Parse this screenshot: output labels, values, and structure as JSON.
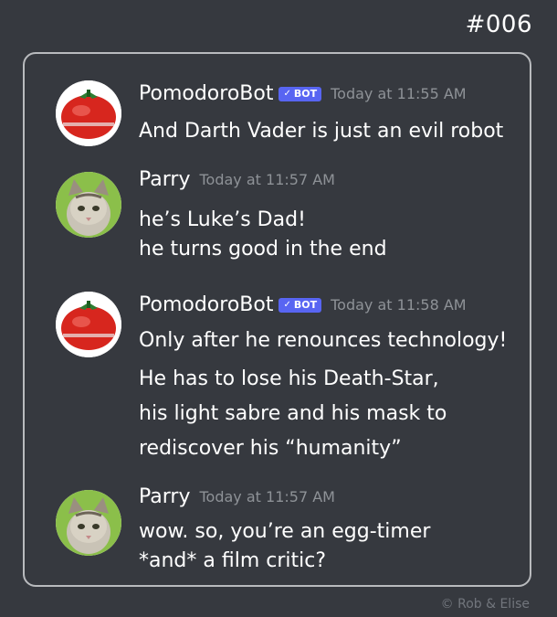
{
  "issue_number": "#006",
  "messages": [
    {
      "author": "PomodoroBot",
      "bot_tag": "BOT",
      "timestamp": "Today at 11:55 AM",
      "lines": [
        "And Darth Vader is just an evil robot"
      ]
    },
    {
      "author": "Parry",
      "timestamp": "Today at 11:57 AM",
      "lines": [
        "he’s Luke’s Dad!",
        "he turns good in the end"
      ]
    },
    {
      "author": "PomodoroBot",
      "bot_tag": "BOT",
      "timestamp": "Today at 11:58 AM",
      "lines": [
        "Only after he renounces technology!",
        "He has to lose his Death-Star,",
        "his light sabre and his mask to",
        "rediscover his “humanity”"
      ]
    },
    {
      "author": "Parry",
      "timestamp": "Today at 11:57 AM",
      "lines": [
        "wow.  so, you’re an egg-timer",
        "*and* a film critic?"
      ]
    }
  ],
  "credit": "©  Rob & Elise",
  "colors": {
    "background": "#36393f",
    "bot_tag": "#5865f2",
    "timestamp": "#8e9297",
    "frame_border": "#b9bbbe"
  },
  "icons": {
    "bot_avatar": "tomato-timer-icon",
    "user_avatar": "cat-icon",
    "verified": "checkmark-icon"
  }
}
